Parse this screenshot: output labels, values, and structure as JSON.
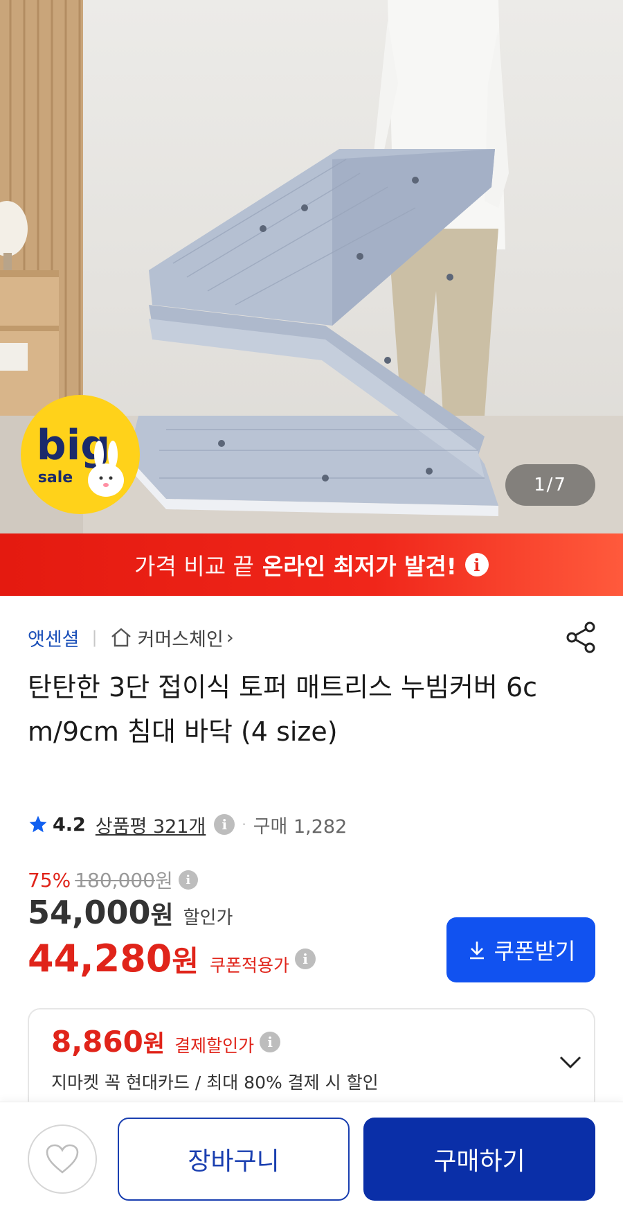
{
  "hero": {
    "image_counter": "1/7",
    "badge_big": "big",
    "badge_sale": "sale"
  },
  "promo": {
    "text_light": "가격 비교 끝",
    "text_strong": "온라인 최저가 발견!",
    "info_icon": "info-icon"
  },
  "seller": {
    "brand": "앳센셜",
    "store": "커머스체인",
    "store_arrow": "›"
  },
  "product": {
    "title": "탄탄한 3단 접이식 토퍼 매트리스 누빔커버 6cm/9cm 침대 바닥 (4 size)"
  },
  "rating": {
    "score": "4.2",
    "reviews": "상품평 321개",
    "purchases": "구매 1,282"
  },
  "price": {
    "discount_pct": "75%",
    "original": "180,000",
    "original_unit": "원",
    "sale": "54,000",
    "sale_unit": "원",
    "sale_label": "할인가",
    "coupon": "44,280",
    "coupon_unit": "원",
    "coupon_label": "쿠폰적용가"
  },
  "coupon_button": {
    "label": "쿠폰받기"
  },
  "card_discount": {
    "price": "8,860",
    "unit": "원",
    "label": "결제할인가",
    "description": "지마켓 꼭 현대카드 / 최대 80% 결제 시 할인"
  },
  "bottom_bar": {
    "cart": "장바구니",
    "buy": "구매하기"
  },
  "colors": {
    "accent_red": "#e0241a",
    "accent_blue": "#1152f0",
    "buy_navy": "#0a2fa8",
    "brand_link": "#1a4fb8"
  }
}
